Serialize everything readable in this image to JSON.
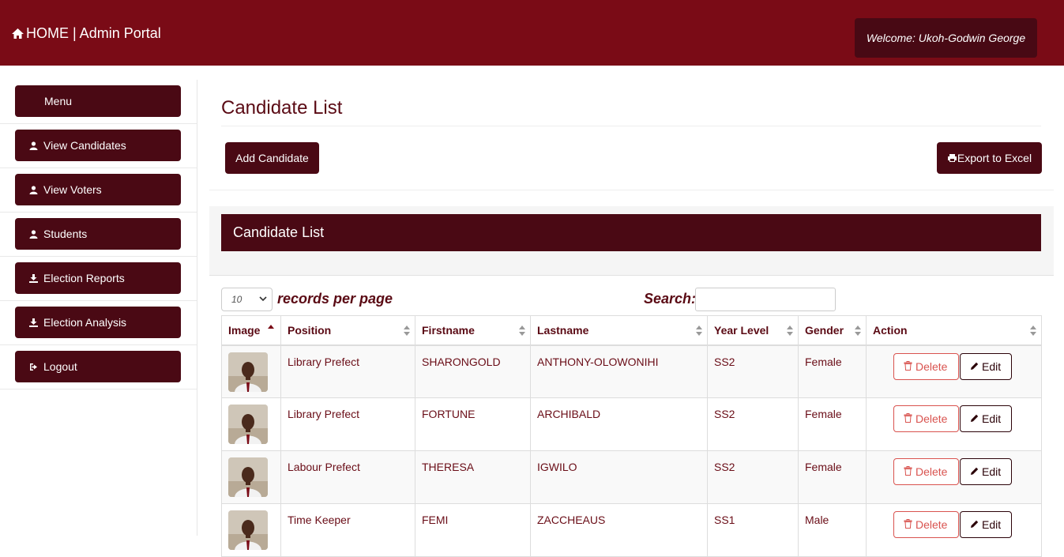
{
  "header": {
    "brand": "HOME | Admin Portal",
    "welcome": "Welcome: Ukoh-Godwin George"
  },
  "sidebar": {
    "items": [
      {
        "label": "Menu",
        "icon": ""
      },
      {
        "label": "View Candidates",
        "icon": "user-icon"
      },
      {
        "label": "View Voters",
        "icon": "user-icon"
      },
      {
        "label": "Students",
        "icon": "user-icon"
      },
      {
        "label": "Election Reports",
        "icon": "download-icon"
      },
      {
        "label": "Election Analysis",
        "icon": "download-icon"
      },
      {
        "label": "Logout",
        "icon": "logout-icon"
      }
    ]
  },
  "main": {
    "title": "Candidate List",
    "add_button": "Add Candidate",
    "export_button": "Export to Excel",
    "panel_title": "Candidate List",
    "length_value": "10",
    "records_per_page": "records per page",
    "search_label": "Search:",
    "search_value": ""
  },
  "table": {
    "columns": [
      "Image",
      "Position",
      "Firstname",
      "Lastname",
      "Year Level",
      "Gender",
      "Action"
    ],
    "rows": [
      {
        "position": "Library Prefect",
        "firstname": "SHARONGOLD",
        "lastname": "ANTHONY-OLOWONIHI",
        "year": "SS2",
        "gender": "Female"
      },
      {
        "position": "Library Prefect",
        "firstname": "FORTUNE",
        "lastname": "ARCHIBALD",
        "year": "SS2",
        "gender": "Female"
      },
      {
        "position": "Labour Prefect",
        "firstname": "THERESA",
        "lastname": "IGWILO",
        "year": "SS2",
        "gender": "Female"
      },
      {
        "position": "Time Keeper",
        "firstname": "FEMI",
        "lastname": "ZACCHEAUS",
        "year": "SS1",
        "gender": "Male"
      }
    ],
    "delete_label": "Delete",
    "edit_label": "Edit"
  },
  "colors": {
    "topbar": "#7a0b16",
    "dark": "#4a0914",
    "danger": "#d9534f"
  }
}
